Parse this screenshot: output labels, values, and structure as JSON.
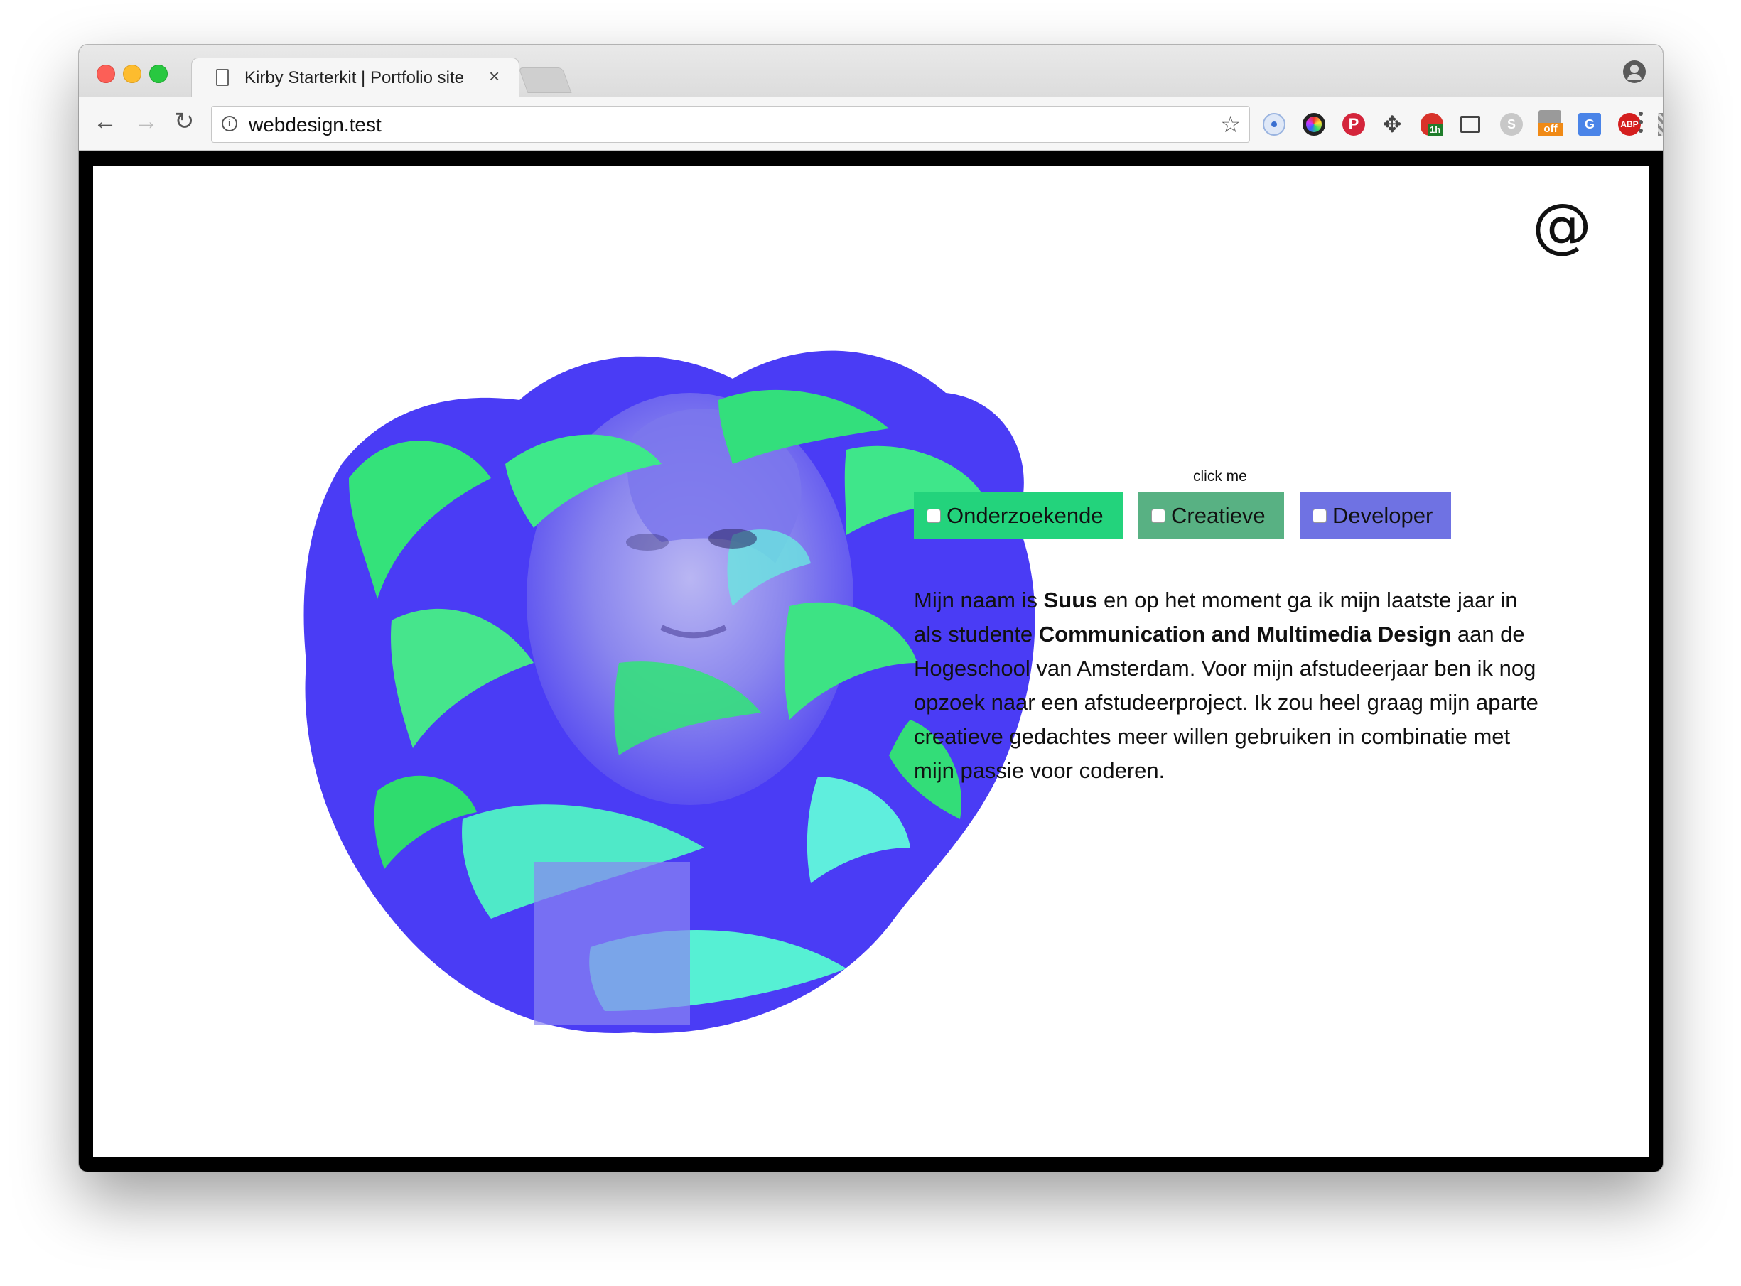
{
  "browser": {
    "tab_title": "Kirby Starterkit | Portfolio site",
    "tab_close": "×",
    "url": "webdesign.test",
    "extensions": [
      "record-icon",
      "color-picker-icon",
      "pinterest-icon",
      "move-tool-icon",
      "tomato-timer-icon",
      "screenshot-icon",
      "skype-icon",
      "deals-off-icon",
      "google-translate-icon",
      "adblock-plus-icon",
      "qr-code-icon"
    ],
    "timer_badge": "1h",
    "off_badge": "off",
    "abp_label": "ABP",
    "skype_label": "S",
    "translate_label": "G"
  },
  "page": {
    "contact_symbol": "@",
    "click_me": "click me",
    "filters": [
      {
        "label": "Onderzoekende",
        "color": "#23d37c"
      },
      {
        "label": "Creatieve",
        "color": "#58b183"
      },
      {
        "label": "Developer",
        "color": "#6f72e3"
      }
    ],
    "bio": {
      "p1": "Mijn naam is ",
      "name": "Suus",
      "p2": " en op het moment ga ik mijn laatste jaar in als studente ",
      "study": "Communication and Multimedia Design",
      "p3": " aan de Hogeschool van Amsterdam. Voor mijn afstudeerjaar ben ik nog opzoek naar een afstudeerproject. Ik zou heel graag mijn aparte creatieve gedachtes meer willen gebruiken in combinatie met mijn passie voor coderen."
    }
  }
}
